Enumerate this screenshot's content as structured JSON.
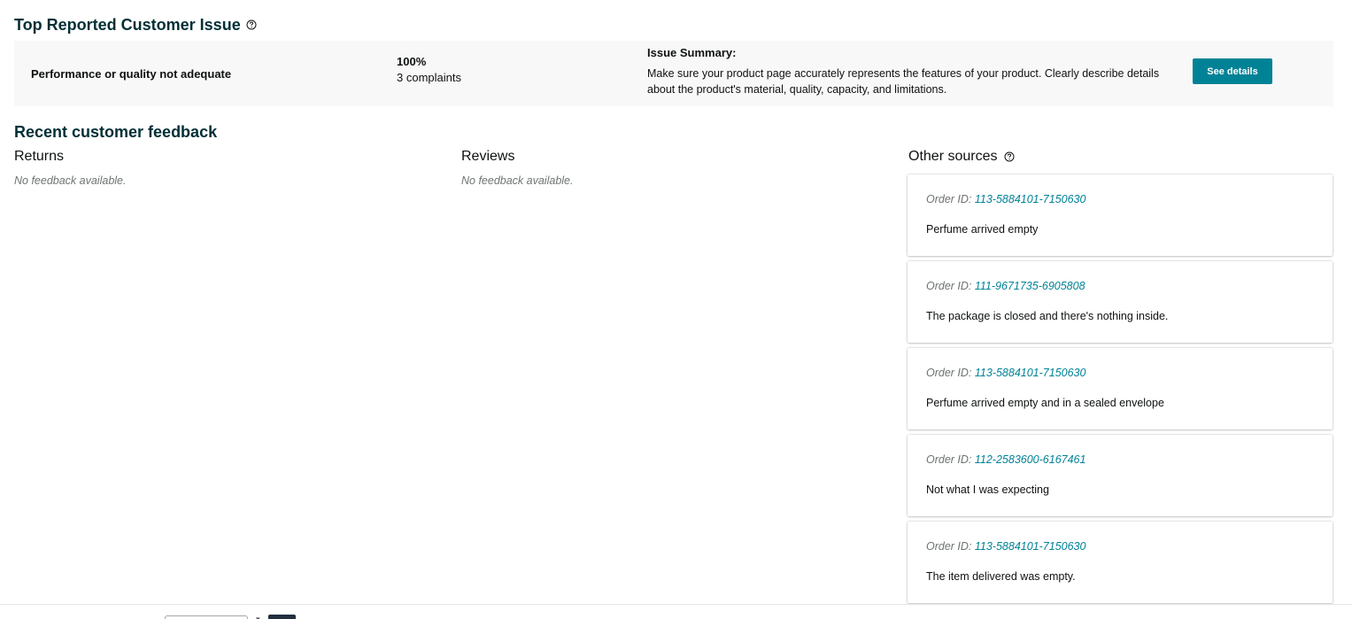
{
  "top_issue": {
    "title": "Top Reported Customer Issue",
    "help_icon": "question-circle-icon",
    "issue_name": "Performance or quality not adequate",
    "percentage": "100%",
    "complaints": "3 complaints",
    "summary_heading": "Issue Summary:",
    "summary_text": "Make sure your product page accurately represents the features of your product. Clearly describe details about the product's material, quality, capacity, and limitations.",
    "button_label": "See details"
  },
  "feedback": {
    "title": "Recent customer feedback",
    "returns": {
      "heading": "Returns",
      "empty_text": "No feedback available."
    },
    "reviews": {
      "heading": "Reviews",
      "empty_text": "No feedback available."
    },
    "other_sources": {
      "heading": "Other sources",
      "help_icon": "question-circle-icon",
      "order_label": "Order ID: ",
      "items": [
        {
          "order_id": "113-5884101-7150630",
          "comment": "Perfume arrived empty"
        },
        {
          "order_id": "111-9671735-6905808",
          "comment": "The package is closed and there's nothing inside."
        },
        {
          "order_id": "113-5884101-7150630",
          "comment": "Perfume arrived empty and in a sealed envelope"
        },
        {
          "order_id": "112-2583600-6167461",
          "comment": "Not what I was expecting"
        },
        {
          "order_id": "113-5884101-7150630",
          "comment": "The item delivered was empty."
        }
      ]
    }
  },
  "colors": {
    "heading": "#002f36",
    "accent": "#008296",
    "panel_bg": "#f8f8f8",
    "muted_text": "#6f7373"
  }
}
